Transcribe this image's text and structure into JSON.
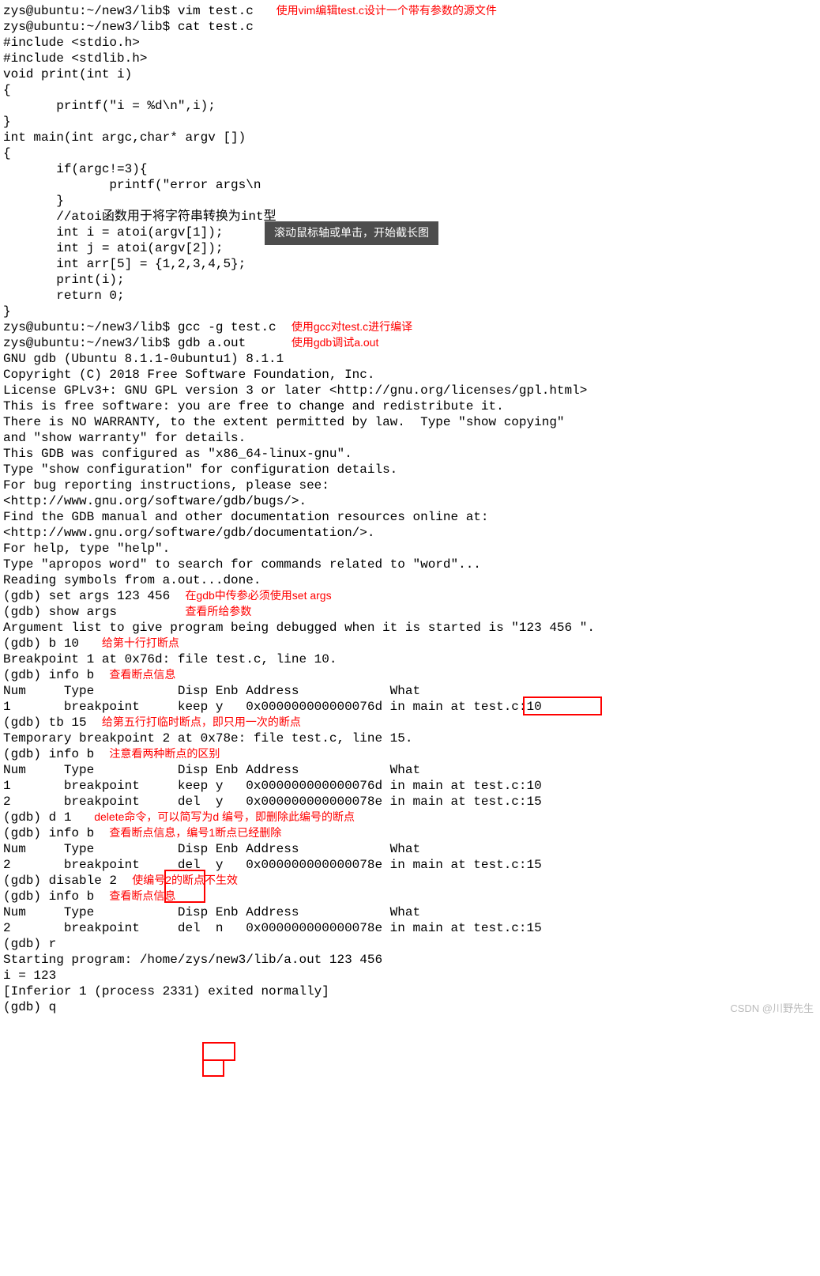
{
  "lines": {
    "l1a": "zys@ubuntu:~/new3/lib$ vim test.c   ",
    "l1b": "使用vim编辑test.c设计一个带有参数的源文件",
    "l2": "zys@ubuntu:~/new3/lib$ cat test.c",
    "l3": "#include <stdio.h>",
    "l4": "#include <stdlib.h>",
    "l5": "",
    "l6": "void print(int i)",
    "l7": "{",
    "l8": "       printf(\"i = %d\\n\",i);",
    "l9": "}",
    "l10": "",
    "l11": "int main(int argc,char* argv [])",
    "l12": "{",
    "l13": "       if(argc!=3){",
    "l14": "              printf(\"error args\\n",
    "l15": "       }",
    "l16": "",
    "l17": "       //atoi函数用于将字符串转换为int型",
    "l18": "       int i = atoi(argv[1]);",
    "l19": "       int j = atoi(argv[2]);",
    "l20": "       int arr[5] = {1,2,3,4,5};",
    "l21": "       print(i);",
    "l22": "       return 0;",
    "l23": "}",
    "l24a": "zys@ubuntu:~/new3/lib$ gcc -g test.c  ",
    "l24b": "使用gcc对test.c进行编译",
    "l25a": "zys@ubuntu:~/new3/lib$ gdb a.out      ",
    "l25b": "使用gdb调试a.out",
    "l26": "GNU gdb (Ubuntu 8.1.1-0ubuntu1) 8.1.1",
    "l27": "Copyright (C) 2018 Free Software Foundation, Inc.",
    "l28": "License GPLv3+: GNU GPL version 3 or later <http://gnu.org/licenses/gpl.html>",
    "l29": "This is free software: you are free to change and redistribute it.",
    "l30": "There is NO WARRANTY, to the extent permitted by law.  Type \"show copying\"",
    "l31": "and \"show warranty\" for details.",
    "l32": "This GDB was configured as \"x86_64-linux-gnu\".",
    "l33": "Type \"show configuration\" for configuration details.",
    "l34": "For bug reporting instructions, please see:",
    "l35": "<http://www.gnu.org/software/gdb/bugs/>.",
    "l36": "Find the GDB manual and other documentation resources online at:",
    "l37": "<http://www.gnu.org/software/gdb/documentation/>.",
    "l38": "For help, type \"help\".",
    "l39": "Type \"apropos word\" to search for commands related to \"word\"...",
    "l40": "Reading symbols from a.out...done.",
    "l41a": "(gdb) set args 123 456  ",
    "l41b": "在gdb中传参必须使用set args",
    "l42a": "(gdb) show args         ",
    "l42b": "查看所给参数",
    "l43": "Argument list to give program being debugged when it is started is \"123 456 \".",
    "l44a": "(gdb) b 10   ",
    "l44b": "给第十行打断点",
    "l45": "Breakpoint 1 at 0x76d: file test.c, line 10.",
    "l46a": "(gdb) info b  ",
    "l46b": "查看断点信息",
    "l47": "Num     Type           Disp Enb Address            What",
    "l48": "1       breakpoint     keep y   0x000000000000076d in main at test.c:10",
    "l49a": "(gdb) tb 15  ",
    "l49b": "给第五行打临时断点，即只用一次的断点",
    "l50": "Temporary breakpoint 2 at 0x78e: file test.c, line 15.",
    "l51a": "(gdb) info b  ",
    "l51b": "注意看两种断点的区别",
    "l52": "Num     Type           Disp Enb Address            What",
    "l53": "1       breakpoint     keep y   0x000000000000076d in main at test.c:10",
    "l54": "2       breakpoint     del  y   0x000000000000078e in main at test.c:15",
    "l55": "",
    "l56": "",
    "l57a": "(gdb) d 1   ",
    "l57b": "delete命令，可以简写为d 编号，即删除此编号的断点",
    "l58a": "(gdb) info b  ",
    "l58b": "查看断点信息，编号1断点已经删除",
    "l59": "Num     Type           Disp Enb Address            What",
    "l60": "2       breakpoint     del  y   0x000000000000078e in main at test.c:15",
    "l61a": "(gdb) disable 2  ",
    "l61b": "使编号2的断点不生效",
    "l62a": "(gdb) info b  ",
    "l62b": "查看断点信息",
    "l63": "Num     Type           Disp Enb Address            What",
    "l64": "2       breakpoint     del  n   0x000000000000078e in main at test.c:15",
    "l65": "(gdb) r",
    "l66": "Starting program: /home/zys/new3/lib/a.out 123 456",
    "l67": "i = 123",
    "l68": "[Inferior 1 (process 2331) exited normally]",
    "l69": "(gdb) q"
  },
  "tooltip": "滚动鼠标轴或单击，开始截长图",
  "watermark": "CSDN @川野先生"
}
